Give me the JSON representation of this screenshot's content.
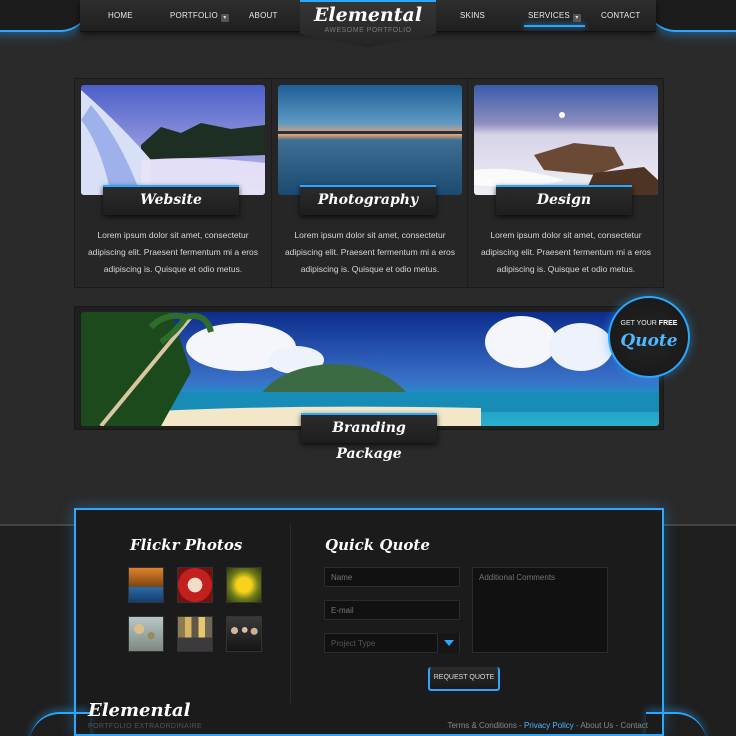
{
  "nav": {
    "items": [
      {
        "label": "HOME",
        "has_dropdown": false
      },
      {
        "label": "PORTFOLIO",
        "has_dropdown": true
      },
      {
        "label": "ABOUT",
        "has_dropdown": false
      },
      {
        "label": "SKINS",
        "has_dropdown": false
      },
      {
        "label": "SERVICES",
        "has_dropdown": true,
        "active": true
      },
      {
        "label": "CONTACT",
        "has_dropdown": false
      }
    ]
  },
  "logo": {
    "title": "Elemental",
    "subtitle": "AWESOME PORTFOLIO"
  },
  "services": [
    {
      "title": "Website",
      "image": "waterfall-photo",
      "text": "Lorem ipsum dolor sit amet, consectetur adipiscing elit. Praesent fermentum mi a eros adipiscing is. Quisque et odio metus."
    },
    {
      "title": "Photography",
      "image": "sunset-lake-photo",
      "text": "Lorem ipsum dolor sit amet, consectetur adipiscing elit. Praesent fermentum mi a eros adipiscing is. Quisque et odio metus."
    },
    {
      "title": "Design",
      "image": "rocky-coast-photo",
      "text": "Lorem ipsum dolor sit amet, consectetur adipiscing elit. Praesent fermentum mi a eros adipiscing is. Quisque et odio metus."
    }
  ],
  "banner": {
    "image": "tropical-beach-photo",
    "label": "Branding Package"
  },
  "quote_badge": {
    "line1_prefix": "GET YOUR",
    "line1_bold": "FREE",
    "line2": "Quote"
  },
  "flickr": {
    "title": "Flickr Photos",
    "photos": [
      "autumn-lake-photo",
      "red-cup-photo",
      "yellow-flower-photo",
      "balloons-photo",
      "city-skyline-photo",
      "group-people-photo"
    ]
  },
  "quick_quote": {
    "title": "Quick Quote",
    "name_placeholder": "Name",
    "email_placeholder": "E-mail",
    "project_type_placeholder": "Project Type",
    "comments_placeholder": "Additional Comments",
    "button_label": "REQUEST QUOTE"
  },
  "footer": {
    "logo": "Elemental",
    "logo_sub": "PORTFOLIO EXTRAORDINAIRE",
    "links": [
      "Terms & Conditions",
      "Privacy Policy",
      "About Us",
      "Contact"
    ],
    "separator": " - "
  },
  "colors": {
    "accent": "#2aa8ff",
    "background": "#2a2a2a",
    "panel": "#1b1b1b"
  }
}
